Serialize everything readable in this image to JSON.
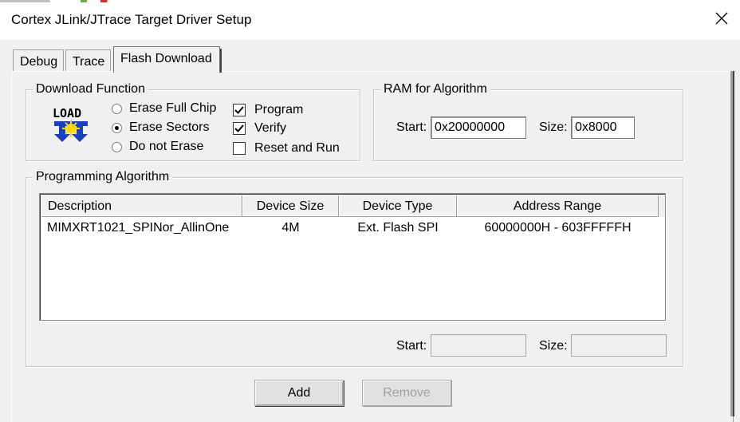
{
  "window": {
    "title": "Cortex JLink/JTrace Target Driver Setup"
  },
  "tabs": [
    {
      "label": "Debug"
    },
    {
      "label": "Trace"
    },
    {
      "label": "Flash Download"
    }
  ],
  "download_function": {
    "group_label": "Download Function",
    "icon_text": "LOAD",
    "radios": [
      {
        "label": "Erase Full Chip",
        "selected": false
      },
      {
        "label": "Erase Sectors",
        "selected": true
      },
      {
        "label": "Do not Erase",
        "selected": false
      }
    ],
    "checks": [
      {
        "label": "Program",
        "checked": true
      },
      {
        "label": "Verify",
        "checked": true
      },
      {
        "label": "Reset and Run",
        "checked": false
      }
    ]
  },
  "ram": {
    "group_label": "RAM for Algorithm",
    "start_label": "Start:",
    "start_value": "0x20000000",
    "size_label": "Size:",
    "size_value": "0x8000"
  },
  "programming": {
    "group_label": "Programming Algorithm",
    "columns": [
      "Description",
      "Device Size",
      "Device Type",
      "Address Range"
    ],
    "rows": [
      {
        "description": "MIMXRT1021_SPINor_AllinOne",
        "size": "4M",
        "type": "Ext. Flash SPI",
        "range": "60000000H - 603FFFFFH"
      }
    ],
    "start_label": "Start:",
    "start_value": "",
    "size_label": "Size:",
    "size_value": ""
  },
  "buttons": {
    "add": "Add",
    "remove": "Remove"
  },
  "colors": {
    "icon_blue": "#1a3fbf",
    "icon_yellow": "#ffd800"
  }
}
